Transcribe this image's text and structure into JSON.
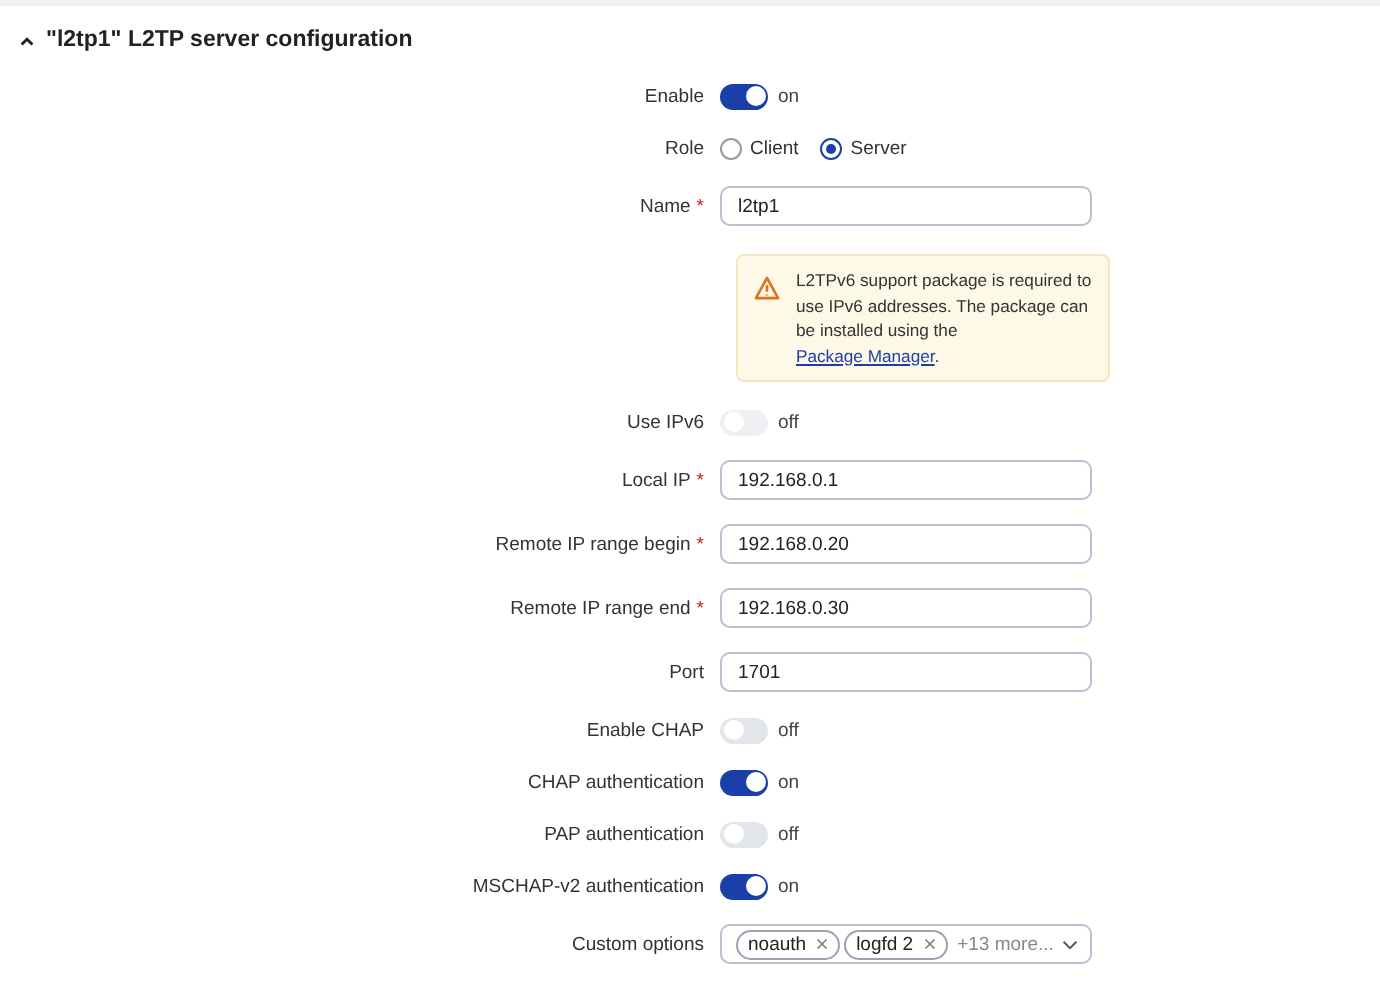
{
  "section": {
    "title": "\"l2tp1\" L2TP server configuration",
    "expanded": true
  },
  "rows": [
    {
      "kind": "toggle",
      "label": "Enable",
      "on": true,
      "state_text": "on"
    },
    {
      "kind": "radio",
      "label": "Role",
      "options": [
        {
          "label": "Client",
          "selected": false
        },
        {
          "label": "Server",
          "selected": true
        }
      ]
    },
    {
      "kind": "input",
      "label": "Name",
      "required_mark": "*",
      "value": "l2tp1"
    },
    {
      "kind": "notice",
      "text": "L2TPv6 support package is required to use IPv6 addresses. The package can be installed using the ",
      "link": "Package Manager",
      "text_after": "."
    },
    {
      "kind": "toggle",
      "label": "Use IPv6",
      "on": false,
      "disabled": true,
      "state_text": "off"
    },
    {
      "kind": "input",
      "label": "Local IP",
      "required_mark": "*",
      "value": "192.168.0.1"
    },
    {
      "kind": "input",
      "label": "Remote IP range begin",
      "required_mark": "*",
      "value": "192.168.0.20"
    },
    {
      "kind": "input",
      "label": "Remote IP range end",
      "required_mark": "*",
      "value": "192.168.0.30"
    },
    {
      "kind": "input",
      "label": "Port",
      "value": "1701"
    },
    {
      "kind": "toggle",
      "label": "Enable CHAP",
      "on": false,
      "state_text": "off"
    },
    {
      "kind": "toggle",
      "label": "CHAP authentication",
      "on": true,
      "state_text": "on"
    },
    {
      "kind": "toggle",
      "label": "PAP authentication",
      "on": false,
      "state_text": "off"
    },
    {
      "kind": "toggle",
      "label": "MSCHAP-v2 authentication",
      "on": true,
      "state_text": "on"
    },
    {
      "kind": "tags",
      "label": "Custom options",
      "tags": [
        "noauth",
        "logfd 2"
      ],
      "more": "+13 more..."
    }
  ]
}
